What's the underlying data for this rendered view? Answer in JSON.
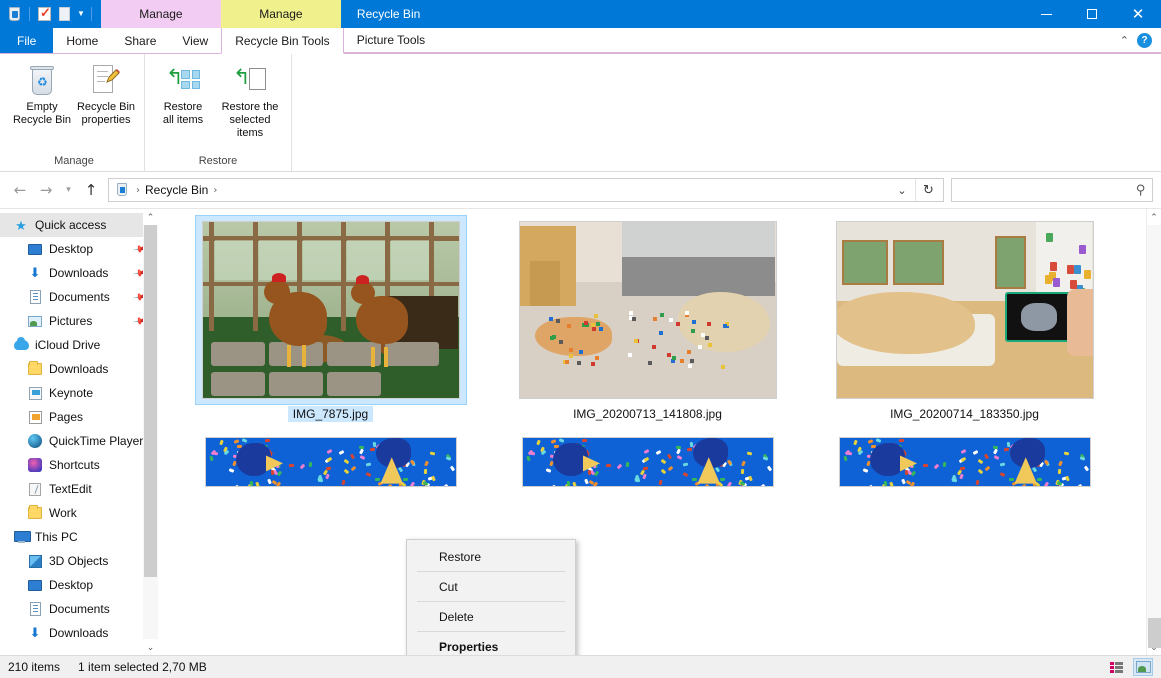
{
  "window": {
    "title": "Recycle Bin",
    "minimize_label": "Minimize",
    "maximize_label": "Maximize",
    "close_label": "Close"
  },
  "quick_access_toolbar": {
    "items": [
      {
        "name": "recycle-bin-icon",
        "label": "Recycle Bin"
      },
      {
        "name": "properties-icon",
        "label": "Properties"
      },
      {
        "name": "new-folder-icon",
        "label": "New folder"
      }
    ],
    "dropdown_label": "Customize Quick Access Toolbar"
  },
  "contextual_tab_groups": [
    {
      "header": "Manage",
      "color": "#f3ccf3",
      "tab": "Recycle Bin Tools"
    },
    {
      "header": "Manage",
      "color": "#f0f08c",
      "tab": "Picture Tools"
    }
  ],
  "tabs": [
    {
      "label": "File",
      "active": false
    },
    {
      "label": "Home",
      "active": false
    },
    {
      "label": "Share",
      "active": false
    },
    {
      "label": "View",
      "active": false
    },
    {
      "label": "Recycle Bin Tools",
      "active": true
    },
    {
      "label": "Picture Tools",
      "active": false
    }
  ],
  "tab_right": {
    "collapse_label": "Minimize the Ribbon",
    "help_label": "?"
  },
  "ribbon": {
    "groups": [
      {
        "label": "Manage",
        "buttons": [
          {
            "line1": "Empty",
            "line2": "Recycle Bin",
            "icon": "empty-recycle-bin-icon"
          },
          {
            "line1": "Recycle Bin",
            "line2": "properties",
            "icon": "recycle-bin-properties-icon"
          }
        ]
      },
      {
        "label": "Restore",
        "buttons": [
          {
            "line1": "Restore",
            "line2": "all items",
            "icon": "restore-all-items-icon"
          },
          {
            "line1": "Restore the",
            "line2": "selected items",
            "icon": "restore-selected-items-icon"
          }
        ]
      }
    ]
  },
  "address_bar": {
    "back_label": "Back",
    "forward_label": "Forward",
    "recent_label": "Recent locations",
    "up_label": "Up",
    "breadcrumbs": [
      "Recycle Bin"
    ],
    "dropdown_label": "Previous locations",
    "refresh_label": "Refresh",
    "search": {
      "value": "",
      "placeholder": ""
    }
  },
  "sidebar": {
    "items": [
      {
        "label": "Quick access",
        "icon": "star-icon",
        "level": 1,
        "selected": true,
        "pinned": false
      },
      {
        "label": "Desktop",
        "icon": "desktop-icon",
        "level": 2,
        "selected": false,
        "pinned": true
      },
      {
        "label": "Downloads",
        "icon": "downloads-icon",
        "level": 2,
        "selected": false,
        "pinned": true
      },
      {
        "label": "Documents",
        "icon": "documents-icon",
        "level": 2,
        "selected": false,
        "pinned": true
      },
      {
        "label": "Pictures",
        "icon": "pictures-icon",
        "level": 2,
        "selected": false,
        "pinned": true
      },
      {
        "label": "iCloud Drive",
        "icon": "icloud-icon",
        "level": 1,
        "selected": false,
        "pinned": false
      },
      {
        "label": "Downloads",
        "icon": "folder-icon",
        "level": 2,
        "selected": false,
        "pinned": false
      },
      {
        "label": "Keynote",
        "icon": "keynote-icon",
        "level": 2,
        "selected": false,
        "pinned": false
      },
      {
        "label": "Pages",
        "icon": "pages-icon",
        "level": 2,
        "selected": false,
        "pinned": false
      },
      {
        "label": "QuickTime Player",
        "icon": "quicktime-icon",
        "level": 2,
        "selected": false,
        "pinned": false
      },
      {
        "label": "Shortcuts",
        "icon": "shortcuts-icon",
        "level": 2,
        "selected": false,
        "pinned": false
      },
      {
        "label": "TextEdit",
        "icon": "textedit-icon",
        "level": 2,
        "selected": false,
        "pinned": false
      },
      {
        "label": "Work",
        "icon": "folder-icon",
        "level": 2,
        "selected": false,
        "pinned": false
      },
      {
        "label": "This PC",
        "icon": "this-pc-icon",
        "level": 1,
        "selected": false,
        "pinned": false
      },
      {
        "label": "3D Objects",
        "icon": "3d-objects-icon",
        "level": 2,
        "selected": false,
        "pinned": false
      },
      {
        "label": "Desktop",
        "icon": "desktop-icon",
        "level": 2,
        "selected": false,
        "pinned": false
      },
      {
        "label": "Documents",
        "icon": "documents-icon",
        "level": 2,
        "selected": false,
        "pinned": false
      },
      {
        "label": "Downloads",
        "icon": "downloads-icon",
        "level": 2,
        "selected": false,
        "pinned": false
      }
    ]
  },
  "files": [
    {
      "name": "IMG_7875.jpg",
      "selected": true,
      "art": "chickens"
    },
    {
      "name": "IMG_20200713_141808.jpg",
      "selected": false,
      "art": "dogcat"
    },
    {
      "name": "IMG_20200714_183350.jpg",
      "selected": false,
      "art": "catphone"
    }
  ],
  "files_partial": [
    {
      "art": "party"
    },
    {
      "art": "party"
    },
    {
      "art": "party"
    }
  ],
  "context_menu": {
    "items": [
      {
        "label": "Restore",
        "bold": false
      },
      {
        "label": "Cut",
        "bold": false
      },
      {
        "label": "Delete",
        "bold": false
      },
      {
        "label": "Properties",
        "bold": true
      }
    ]
  },
  "status_bar": {
    "item_count": "210 items",
    "selection": "1 item selected  2,70 MB",
    "details_view_label": "Details view",
    "large_icons_view_label": "Large icons view"
  }
}
